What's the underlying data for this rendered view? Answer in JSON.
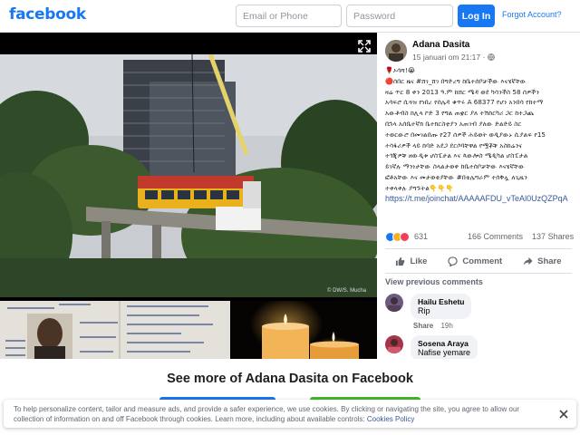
{
  "header": {
    "logo": "facebook",
    "email_placeholder": "Email or Phone",
    "password_placeholder": "Password",
    "login_label": "Log In",
    "forgot_label": "Forgot Account?"
  },
  "photo": {
    "credit": "© DW/S. Mucha"
  },
  "post": {
    "author": "Adana Dasita",
    "date": "15 januari om 21:17 · ",
    "text_lines": [
      "🌹ኦሳሻ!😭",
      "🔴ሰበር ዜና #ሸገ_ሸገ በግድረግ ከቤተሰቦቻችው እናሄኛቸው",
      "ዛሬ ጥር 8 ቀን 2013 ዓ.ም ከሸር ሜዳ ወደ ካሳንችስ 58 ሰዎችን",
      "አሳፍሮ ሲጓዝ የነበረ የሰሌዳ ቁጥሩ A 68377 የሆነ አንበሳ የከተማ",
      "አውቶብስ ከሊላ ኮድ 3 የግል ጠቋር ያለ ተሽከርካሪ ጋር ከተጋጨ",
      "በኋላ አሰቤተኛክ ቤተክርስቲያን አጠገብ ያለው ድልድይ ስር",
      "ተወርውሮ በመገልበጡ የ27 ሰዎች ሕይወት ወዲያውኑ ሲያልፍ የ15",
      "ተሳፋሪዎች ላይ ከባድ አደጋ ደርሶባቸዋል የሟቾቹ አስከሬንና",
      "ተጎጂዎቹ ዘውዲቱ ሆስፒታል እና ጳውሎስ ሜዲካል ሆስፒታል",
      "ይገኛሉ ማንነታቸው ስላልታወቀ ከቤተሰቦቻቸው እናሄኛቸው",
      "ፎቶአቸው እና መታወቂያቸው #በቴሌግራም ተሰቅሏ ለጊዜን",
      "ተቀላቀሉ ያግኙትል👇👇👇"
    ],
    "link": "https://t.me/joinchat/AAAAAFDU_vTeAl0UzQZPqA",
    "reaction_count": "631",
    "comments_count": "166 Comments",
    "shares_count": "137 Shares",
    "actions": {
      "like": "Like",
      "comment": "Comment",
      "share": "Share"
    },
    "view_previous": "View previous comments",
    "comments": [
      {
        "name": "Hailu Eshetu",
        "text": "Rip",
        "action": "Share",
        "time": "19h"
      },
      {
        "name": "Sosena Araya",
        "text": "Nafise yemare",
        "action": "",
        "time": ""
      }
    ]
  },
  "footer": {
    "see_more": "See more of Adana Dasita on Facebook",
    "cookie_text": "To help personalize content, tailor and measure ads, and provide a safer experience, we use cookies. By clicking or navigating the site, you agree to allow our collection of information on and off Facebook through cookies. Learn more, including about available controls: ",
    "cookie_link": "Cookies Policy"
  },
  "colors": {
    "brand": "#1877f2",
    "link": "#385898",
    "background": "#e9ebee"
  }
}
